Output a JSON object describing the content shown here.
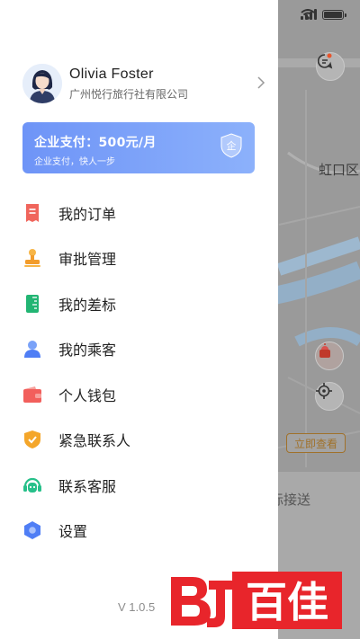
{
  "profile": {
    "name": "Olivia Foster",
    "company": "广州悦行旅行社有限公司"
  },
  "payment_card": {
    "title": "企业支付：500元/月",
    "subtitle": "企业支付，快人一步",
    "badge": "企"
  },
  "menu": [
    {
      "label": "我的订单",
      "icon": "order-icon",
      "color": "#f0655c"
    },
    {
      "label": "审批管理",
      "icon": "stamp-icon",
      "color": "#f29c2b"
    },
    {
      "label": "我的差标",
      "icon": "ruler-icon",
      "color": "#22b573"
    },
    {
      "label": "我的乘客",
      "icon": "passenger-icon",
      "color": "#4f7ef5"
    },
    {
      "label": "个人钱包",
      "icon": "wallet-icon",
      "color": "#f25f5c"
    },
    {
      "label": "紧急联系人",
      "icon": "shield-check-icon",
      "color": "#f4a62a"
    },
    {
      "label": "联系客服",
      "icon": "customer-service-icon",
      "color": "#27c08a"
    },
    {
      "label": "设置",
      "icon": "settings-hex-icon",
      "color": "#4f7ef5"
    }
  ],
  "version": "V 1.0.5",
  "map": {
    "district_label": "虹口区",
    "check_button": "立即查看",
    "bottom_text": "际接送"
  },
  "watermark": "百佳",
  "colors": {
    "card_gradient_start": "#6e94f7",
    "card_gradient_end": "#8cb1fb",
    "watermark_red": "#e8252b"
  }
}
